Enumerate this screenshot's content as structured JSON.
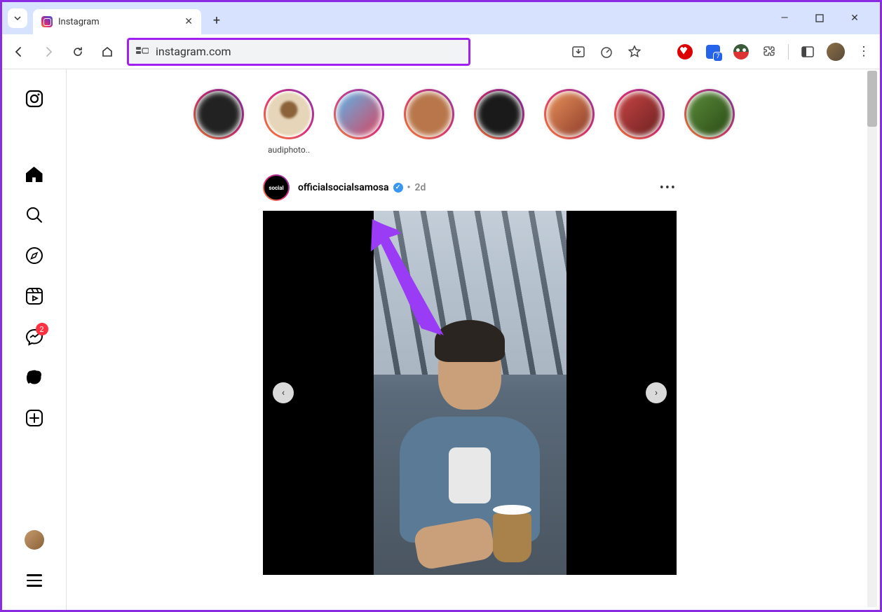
{
  "browser": {
    "tab_title": "Instagram",
    "url": "instagram.com",
    "extension_badge": "7",
    "window_controls": {
      "minimize": "—",
      "maximize": "▢",
      "close": "✕"
    }
  },
  "sidebar": {
    "items": [
      "instagram-logo",
      "home",
      "search",
      "explore",
      "reels",
      "messages",
      "notifications",
      "create",
      "profile"
    ],
    "messages_badge": "2"
  },
  "stories": [
    {
      "label": ""
    },
    {
      "label": "audiphoto.."
    },
    {
      "label": ""
    },
    {
      "label": ""
    },
    {
      "label": ""
    },
    {
      "label": ""
    },
    {
      "label": ""
    },
    {
      "label": ""
    }
  ],
  "post": {
    "avatar_text": "social",
    "username": "officialsocialsamosa",
    "verified": true,
    "timestamp": "2d",
    "more": "•••"
  }
}
